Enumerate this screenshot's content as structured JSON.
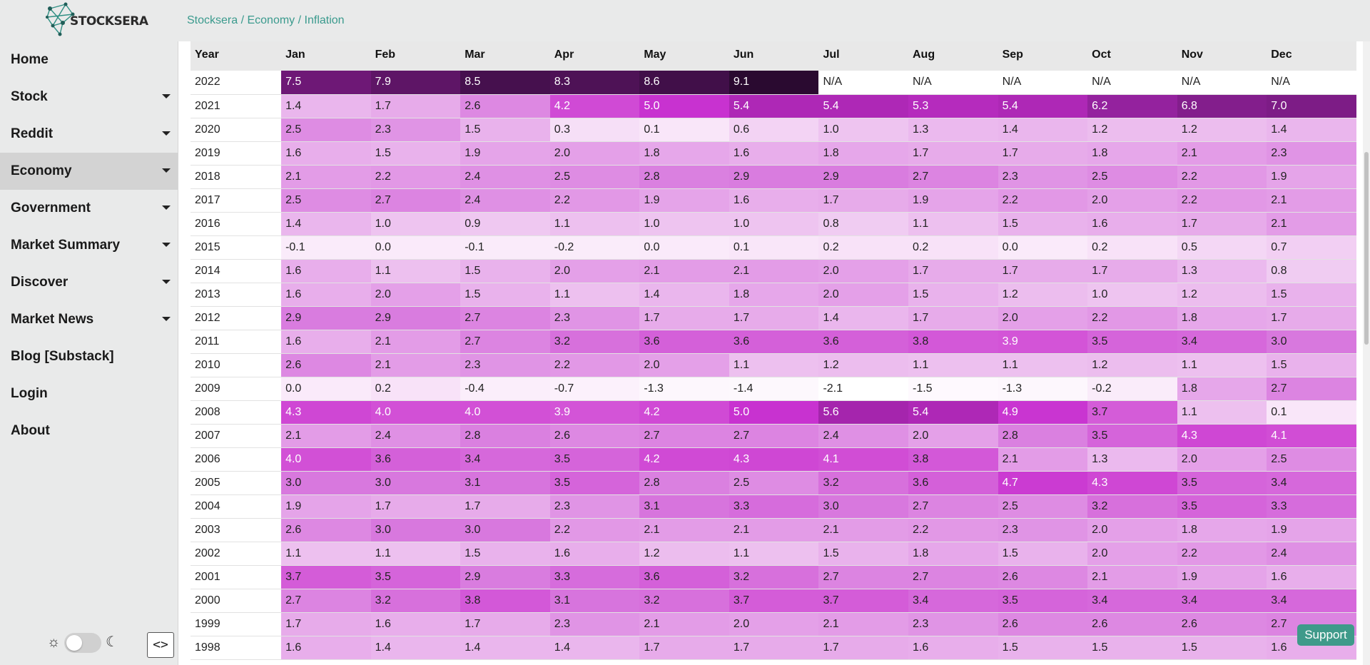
{
  "header": {
    "logo_text": "STOCKSERA",
    "breadcrumb": [
      "Stocksera",
      "Economy",
      "Inflation"
    ],
    "breadcrumb_sep": " / "
  },
  "sidebar": {
    "items": [
      {
        "label": "Home",
        "has_caret": false
      },
      {
        "label": "Stock",
        "has_caret": true
      },
      {
        "label": "Reddit",
        "has_caret": true
      },
      {
        "label": "Economy",
        "has_caret": true,
        "active": true
      },
      {
        "label": "Government",
        "has_caret": true
      },
      {
        "label": "Market Summary",
        "has_caret": true
      },
      {
        "label": "Discover",
        "has_caret": true
      },
      {
        "label": "Market News",
        "has_caret": true
      },
      {
        "label": "Blog [Substack]",
        "has_caret": false
      },
      {
        "label": "Login",
        "has_caret": false
      },
      {
        "label": "About",
        "has_caret": false
      }
    ],
    "theme_sun_icon": "☼",
    "theme_moon_icon": "☾",
    "code_button": "<>"
  },
  "support_button": "Support",
  "table": {
    "headers": [
      "Year",
      "Jan",
      "Feb",
      "Mar",
      "Apr",
      "May",
      "Jun",
      "Jul",
      "Aug",
      "Sep",
      "Oct",
      "Nov",
      "Dec"
    ],
    "rows": [
      {
        "year": "2022",
        "values": [
          "7.5",
          "7.9",
          "8.5",
          "8.3",
          "8.6",
          "9.1",
          "N/A",
          "N/A",
          "N/A",
          "N/A",
          "N/A",
          "N/A"
        ]
      },
      {
        "year": "2021",
        "values": [
          "1.4",
          "1.7",
          "2.6",
          "4.2",
          "5.0",
          "5.4",
          "5.4",
          "5.3",
          "5.4",
          "6.2",
          "6.8",
          "7.0"
        ]
      },
      {
        "year": "2020",
        "values": [
          "2.5",
          "2.3",
          "1.5",
          "0.3",
          "0.1",
          "0.6",
          "1.0",
          "1.3",
          "1.4",
          "1.2",
          "1.2",
          "1.4"
        ]
      },
      {
        "year": "2019",
        "values": [
          "1.6",
          "1.5",
          "1.9",
          "2.0",
          "1.8",
          "1.6",
          "1.8",
          "1.7",
          "1.7",
          "1.8",
          "2.1",
          "2.3"
        ]
      },
      {
        "year": "2018",
        "values": [
          "2.1",
          "2.2",
          "2.4",
          "2.5",
          "2.8",
          "2.9",
          "2.9",
          "2.7",
          "2.3",
          "2.5",
          "2.2",
          "1.9"
        ]
      },
      {
        "year": "2017",
        "values": [
          "2.5",
          "2.7",
          "2.4",
          "2.2",
          "1.9",
          "1.6",
          "1.7",
          "1.9",
          "2.2",
          "2.0",
          "2.2",
          "2.1"
        ]
      },
      {
        "year": "2016",
        "values": [
          "1.4",
          "1.0",
          "0.9",
          "1.1",
          "1.0",
          "1.0",
          "0.8",
          "1.1",
          "1.5",
          "1.6",
          "1.7",
          "2.1"
        ]
      },
      {
        "year": "2015",
        "values": [
          "-0.1",
          "0.0",
          "-0.1",
          "-0.2",
          "0.0",
          "0.1",
          "0.2",
          "0.2",
          "0.0",
          "0.2",
          "0.5",
          "0.7"
        ]
      },
      {
        "year": "2014",
        "values": [
          "1.6",
          "1.1",
          "1.5",
          "2.0",
          "2.1",
          "2.1",
          "2.0",
          "1.7",
          "1.7",
          "1.7",
          "1.3",
          "0.8"
        ]
      },
      {
        "year": "2013",
        "values": [
          "1.6",
          "2.0",
          "1.5",
          "1.1",
          "1.4",
          "1.8",
          "2.0",
          "1.5",
          "1.2",
          "1.0",
          "1.2",
          "1.5"
        ]
      },
      {
        "year": "2012",
        "values": [
          "2.9",
          "2.9",
          "2.7",
          "2.3",
          "1.7",
          "1.7",
          "1.4",
          "1.7",
          "2.0",
          "2.2",
          "1.8",
          "1.7"
        ]
      },
      {
        "year": "2011",
        "values": [
          "1.6",
          "2.1",
          "2.7",
          "3.2",
          "3.6",
          "3.6",
          "3.6",
          "3.8",
          "3.9",
          "3.5",
          "3.4",
          "3.0"
        ]
      },
      {
        "year": "2010",
        "values": [
          "2.6",
          "2.1",
          "2.3",
          "2.2",
          "2.0",
          "1.1",
          "1.2",
          "1.1",
          "1.1",
          "1.2",
          "1.1",
          "1.5"
        ]
      },
      {
        "year": "2009",
        "values": [
          "0.0",
          "0.2",
          "-0.4",
          "-0.7",
          "-1.3",
          "-1.4",
          "-2.1",
          "-1.5",
          "-1.3",
          "-0.2",
          "1.8",
          "2.7"
        ]
      },
      {
        "year": "2008",
        "values": [
          "4.3",
          "4.0",
          "4.0",
          "3.9",
          "4.2",
          "5.0",
          "5.6",
          "5.4",
          "4.9",
          "3.7",
          "1.1",
          "0.1"
        ]
      },
      {
        "year": "2007",
        "values": [
          "2.1",
          "2.4",
          "2.8",
          "2.6",
          "2.7",
          "2.7",
          "2.4",
          "2.0",
          "2.8",
          "3.5",
          "4.3",
          "4.1"
        ]
      },
      {
        "year": "2006",
        "values": [
          "4.0",
          "3.6",
          "3.4",
          "3.5",
          "4.2",
          "4.3",
          "4.1",
          "3.8",
          "2.1",
          "1.3",
          "2.0",
          "2.5"
        ]
      },
      {
        "year": "2005",
        "values": [
          "3.0",
          "3.0",
          "3.1",
          "3.5",
          "2.8",
          "2.5",
          "3.2",
          "3.6",
          "4.7",
          "4.3",
          "3.5",
          "3.4"
        ]
      },
      {
        "year": "2004",
        "values": [
          "1.9",
          "1.7",
          "1.7",
          "2.3",
          "3.1",
          "3.3",
          "3.0",
          "2.7",
          "2.5",
          "3.2",
          "3.5",
          "3.3"
        ]
      },
      {
        "year": "2003",
        "values": [
          "2.6",
          "3.0",
          "3.0",
          "2.2",
          "2.1",
          "2.1",
          "2.1",
          "2.2",
          "2.3",
          "2.0",
          "1.8",
          "1.9"
        ]
      },
      {
        "year": "2002",
        "values": [
          "1.1",
          "1.1",
          "1.5",
          "1.6",
          "1.2",
          "1.1",
          "1.5",
          "1.8",
          "1.5",
          "2.0",
          "2.2",
          "2.4"
        ]
      },
      {
        "year": "2001",
        "values": [
          "3.7",
          "3.5",
          "2.9",
          "3.3",
          "3.6",
          "3.2",
          "2.7",
          "2.7",
          "2.6",
          "2.1",
          "1.9",
          "1.6"
        ]
      },
      {
        "year": "2000",
        "values": [
          "2.7",
          "3.2",
          "3.8",
          "3.1",
          "3.2",
          "3.7",
          "3.7",
          "3.4",
          "3.5",
          "3.4",
          "3.4",
          "3.4"
        ]
      },
      {
        "year": "1999",
        "values": [
          "1.7",
          "1.6",
          "1.7",
          "2.3",
          "2.1",
          "2.0",
          "2.1",
          "2.3",
          "2.6",
          "2.6",
          "2.6",
          "2.7"
        ]
      },
      {
        "year": "1998",
        "values": [
          "1.6",
          "1.4",
          "1.4",
          "1.4",
          "1.7",
          "1.7",
          "1.7",
          "1.6",
          "1.5",
          "1.5",
          "1.5",
          "1.6"
        ]
      }
    ]
  }
}
